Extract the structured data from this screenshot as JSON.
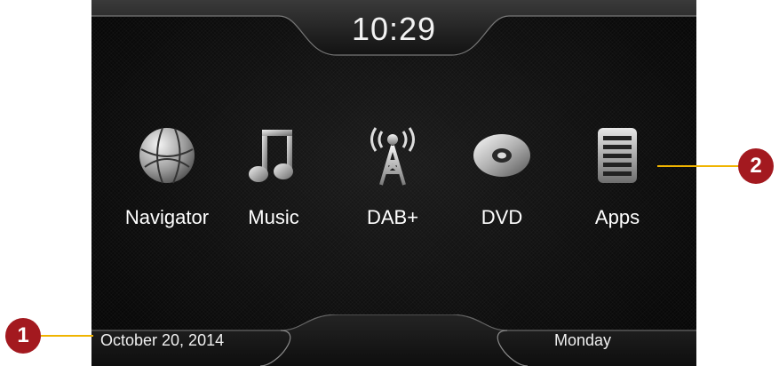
{
  "status": {
    "time": "10:29",
    "date": "October 20, 2014",
    "day": "Monday"
  },
  "apps": [
    {
      "label": "Navigator",
      "icon": "globe-icon"
    },
    {
      "label": "Music",
      "icon": "music-note-icon"
    },
    {
      "label": "DAB+",
      "icon": "radio-tower-icon"
    },
    {
      "label": "DVD",
      "icon": "disc-icon"
    },
    {
      "label": "Apps",
      "icon": "apps-list-icon"
    }
  ],
  "callouts": [
    {
      "number": "1"
    },
    {
      "number": "2"
    }
  ],
  "colors": {
    "callout_line": "#f0b400",
    "badge": "#a3191f",
    "background": "#0b0b0b"
  }
}
